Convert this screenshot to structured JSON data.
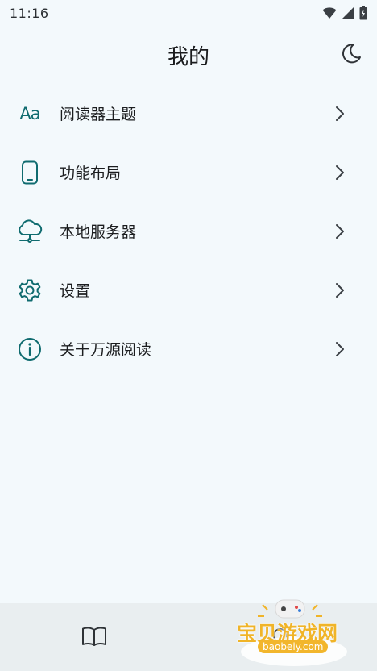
{
  "status_bar": {
    "time": "11:16"
  },
  "header": {
    "title": "我的"
  },
  "menu": {
    "items": [
      {
        "label": "阅读器主题",
        "icon": "text-format-icon",
        "icon_text": "Aa"
      },
      {
        "label": "功能布局",
        "icon": "phone-icon"
      },
      {
        "label": "本地服务器",
        "icon": "cloud-server-icon"
      },
      {
        "label": "设置",
        "icon": "gear-icon"
      },
      {
        "label": "关于万源阅读",
        "icon": "info-icon"
      }
    ]
  },
  "colors": {
    "accent": "#0f6b6f",
    "background": "#f3f9fc",
    "nav_background": "#e9eef0"
  },
  "watermark": {
    "text": "宝贝游戏网",
    "url": "baobeiy.com"
  }
}
